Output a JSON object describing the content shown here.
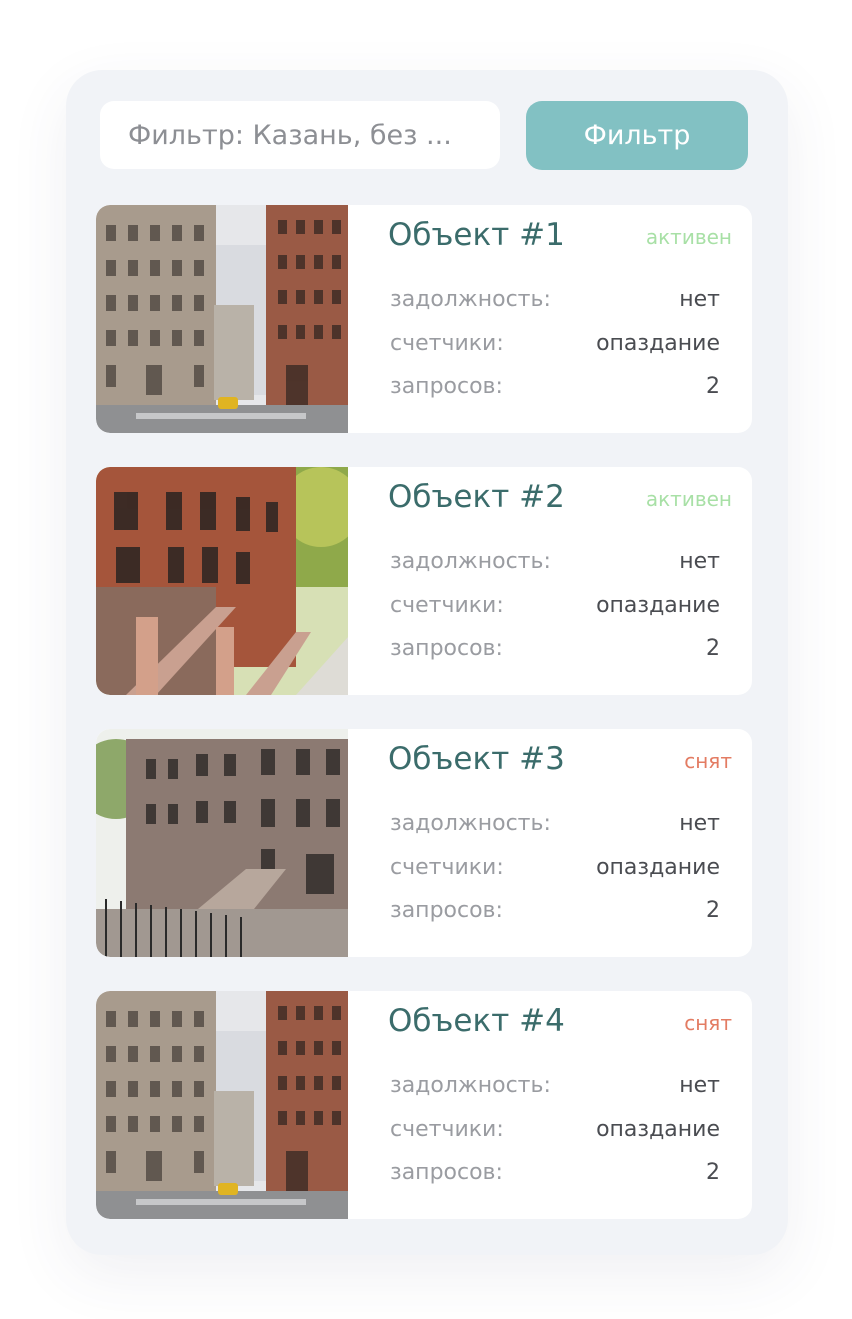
{
  "filter": {
    "placeholder": "Фильтр: Казань, без ...",
    "button_label": "Фильтр"
  },
  "status_colors": {
    "active": "#a8e0a6",
    "removed": "#e37c63"
  },
  "accent_color": "#82c1c3",
  "cards": [
    {
      "title": "Объект #1",
      "status": "активен",
      "status_kind": "active",
      "image": "street-corner-photo",
      "rows": [
        {
          "label": "задолжность:",
          "value": "нет"
        },
        {
          "label": "счетчики:",
          "value": "опаздание"
        },
        {
          "label": "запросов:",
          "value": "2"
        }
      ]
    },
    {
      "title": "Объект #2",
      "status": "активен",
      "status_kind": "active",
      "image": "brownstone-stairs-photo",
      "rows": [
        {
          "label": "задолжность:",
          "value": "нет"
        },
        {
          "label": "счетчики:",
          "value": "опаздание"
        },
        {
          "label": "запросов:",
          "value": "2"
        }
      ]
    },
    {
      "title": "Объект #3",
      "status": "снят",
      "status_kind": "removed",
      "image": "brownstone-row-photo",
      "rows": [
        {
          "label": "задолжность:",
          "value": "нет"
        },
        {
          "label": "счетчики:",
          "value": "опаздание"
        },
        {
          "label": "запросов:",
          "value": "2"
        }
      ]
    },
    {
      "title": "Объект #4",
      "status": "снят",
      "status_kind": "removed",
      "image": "street-corner-photo",
      "rows": [
        {
          "label": "задолжность:",
          "value": "нет"
        },
        {
          "label": "счетчики:",
          "value": "опаздание"
        },
        {
          "label": "запросов:",
          "value": "2"
        }
      ]
    }
  ]
}
